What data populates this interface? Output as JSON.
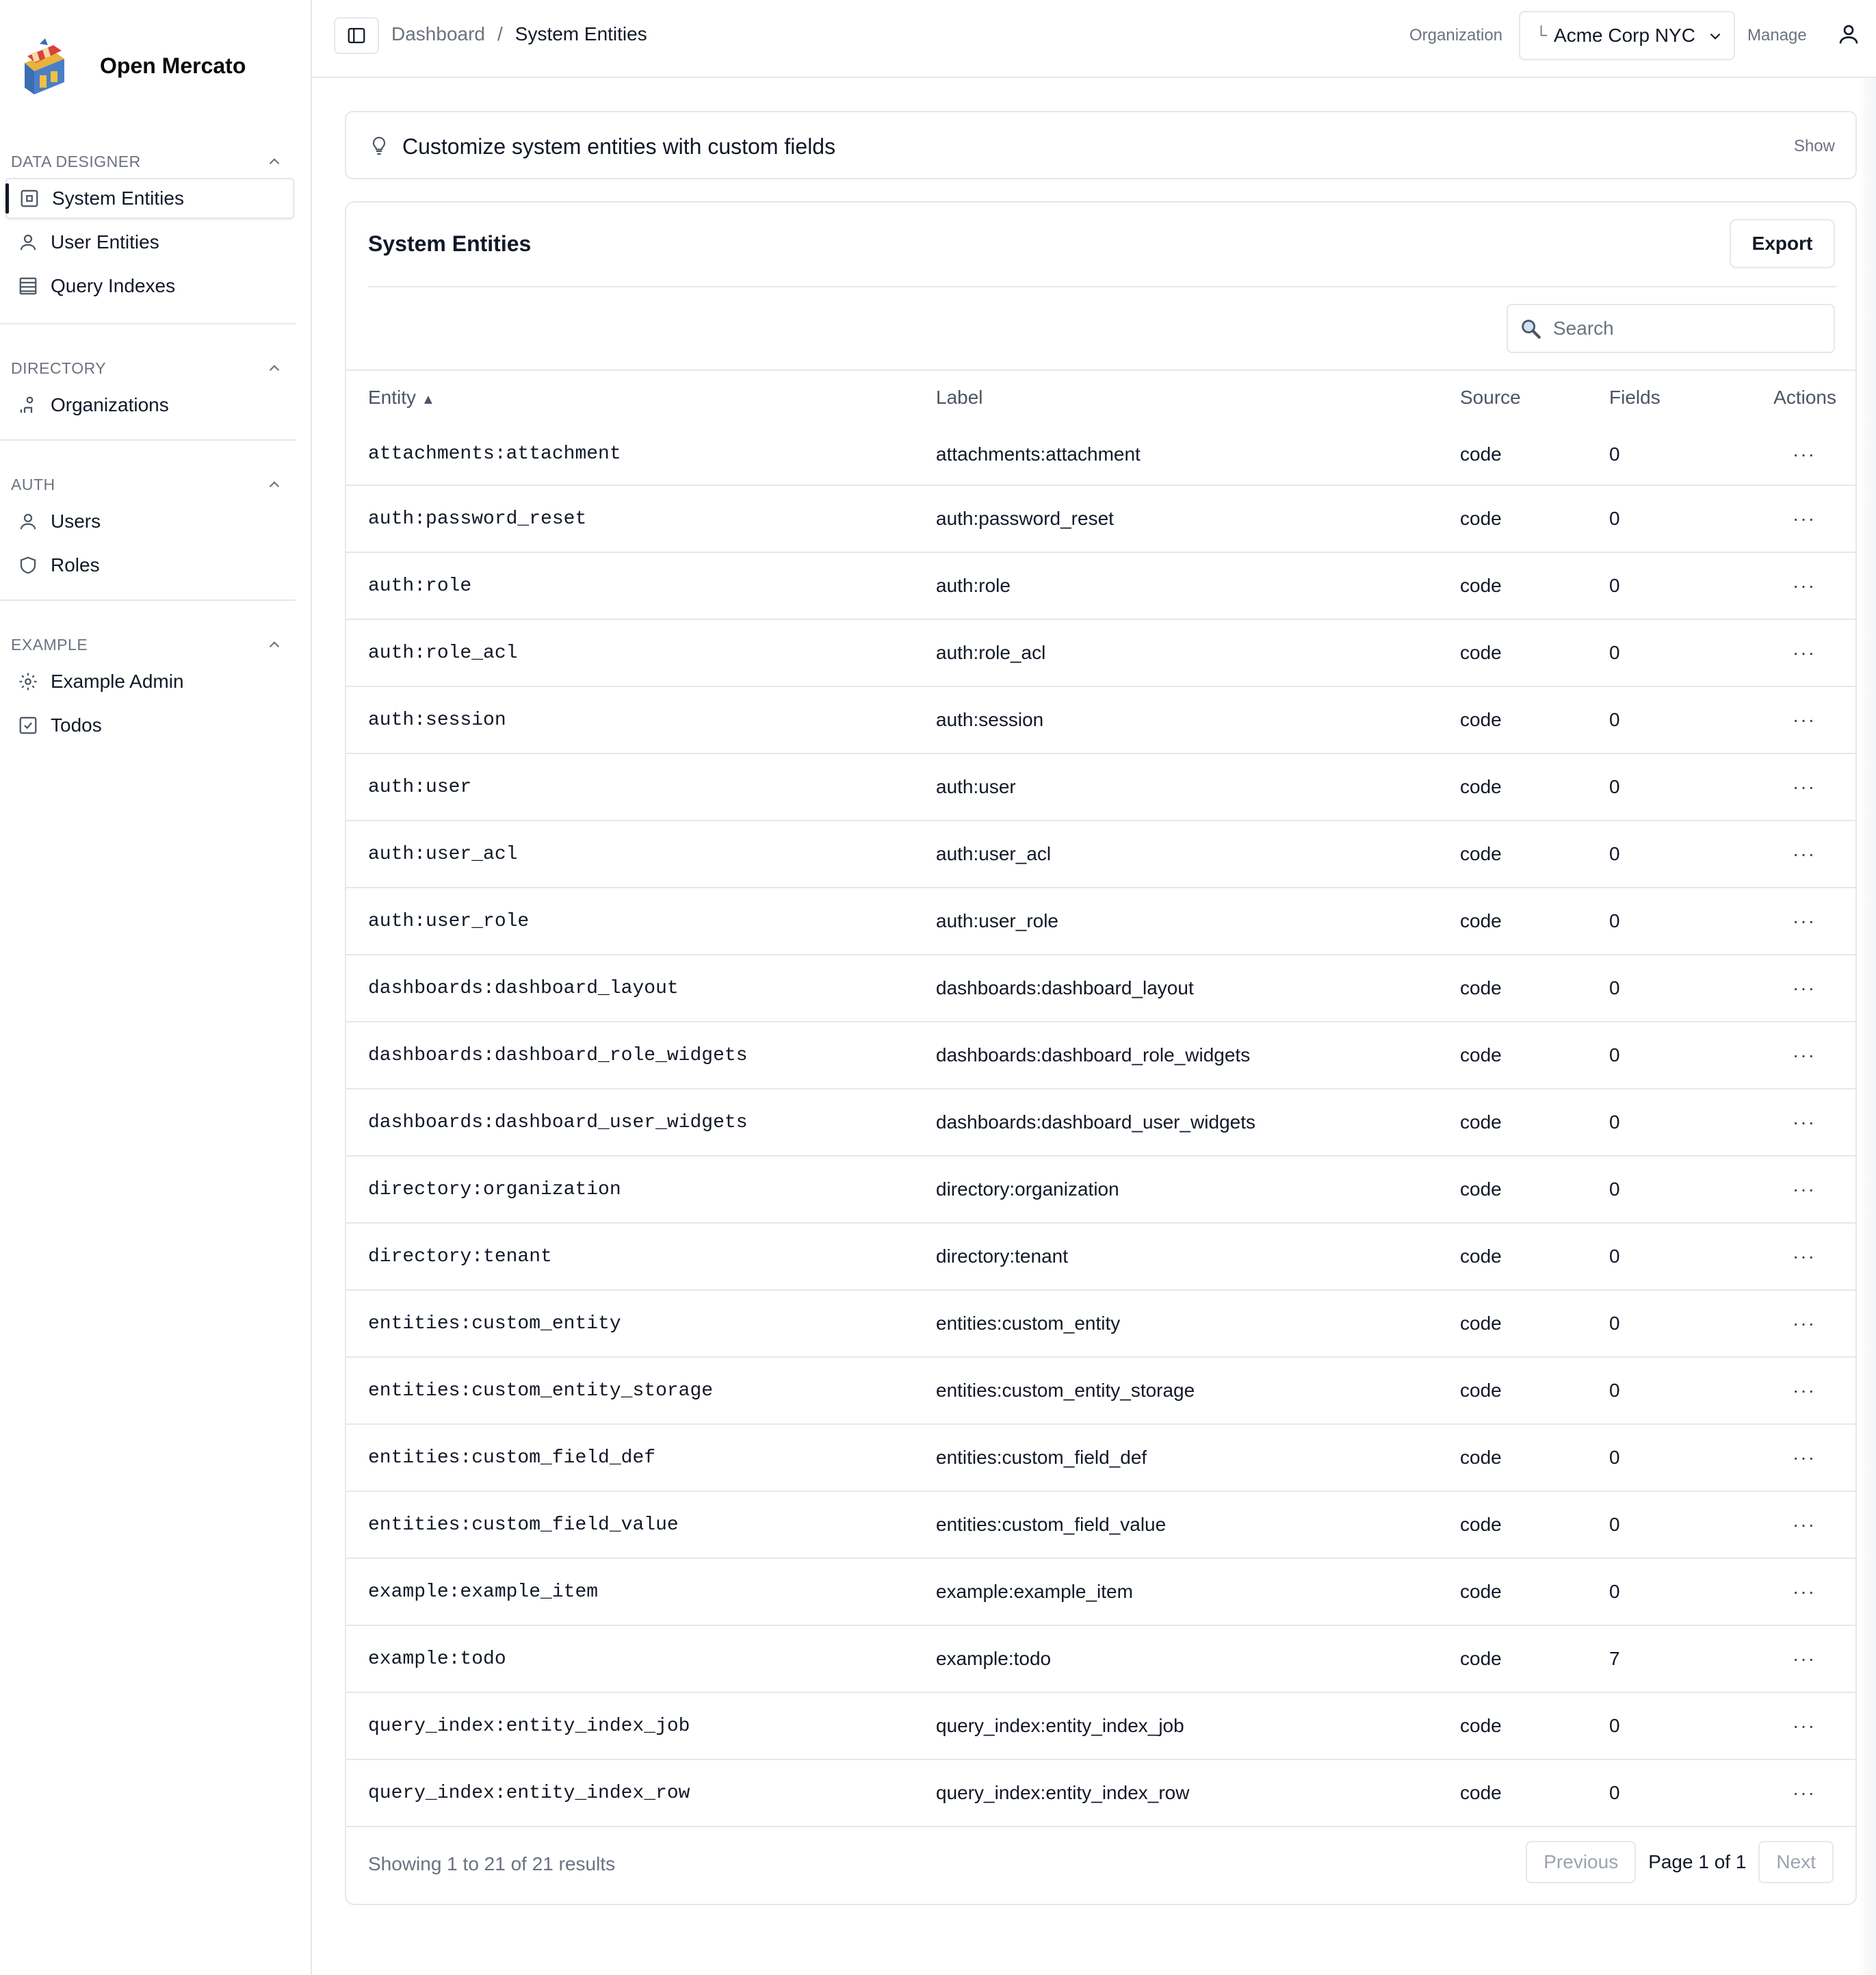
{
  "app": {
    "name": "Open Mercato"
  },
  "sidebar": {
    "sections": [
      {
        "title": "DATA DESIGNER",
        "items": [
          {
            "label": "System Entities",
            "icon": "box-icon",
            "active": true
          },
          {
            "label": "User Entities",
            "icon": "user-icon"
          },
          {
            "label": "Query Indexes",
            "icon": "database-icon"
          }
        ]
      },
      {
        "title": "DIRECTORY",
        "items": [
          {
            "label": "Organizations",
            "icon": "org-icon"
          }
        ]
      },
      {
        "title": "AUTH",
        "items": [
          {
            "label": "Users",
            "icon": "user-icon"
          },
          {
            "label": "Roles",
            "icon": "shield-icon"
          }
        ]
      },
      {
        "title": "EXAMPLE",
        "items": [
          {
            "label": "Example Admin",
            "icon": "gear-icon"
          },
          {
            "label": "Todos",
            "icon": "checkbox-icon"
          }
        ]
      }
    ]
  },
  "header": {
    "breadcrumb": [
      "Dashboard",
      "System Entities"
    ],
    "breadcrumb_sep": "/",
    "org_label": "Organization",
    "org_value": "Acme Corp NYC",
    "org_prefix": "└",
    "manage_label": "Manage"
  },
  "tip": {
    "text": "Customize system entities with custom fields",
    "toggle": "Show"
  },
  "card": {
    "title": "System Entities",
    "export_label": "Export",
    "search_placeholder": "Search",
    "columns": [
      "Entity",
      "Label",
      "Source",
      "Fields",
      "Actions"
    ],
    "sort_indicator": "▲",
    "actions_glyph": "···",
    "rows": [
      {
        "entity": "attachments:attachment",
        "label": "attachments:attachment",
        "source": "code",
        "fields": "0"
      },
      {
        "entity": "auth:password_reset",
        "label": "auth:password_reset",
        "source": "code",
        "fields": "0"
      },
      {
        "entity": "auth:role",
        "label": "auth:role",
        "source": "code",
        "fields": "0"
      },
      {
        "entity": "auth:role_acl",
        "label": "auth:role_acl",
        "source": "code",
        "fields": "0"
      },
      {
        "entity": "auth:session",
        "label": "auth:session",
        "source": "code",
        "fields": "0"
      },
      {
        "entity": "auth:user",
        "label": "auth:user",
        "source": "code",
        "fields": "0"
      },
      {
        "entity": "auth:user_acl",
        "label": "auth:user_acl",
        "source": "code",
        "fields": "0"
      },
      {
        "entity": "auth:user_role",
        "label": "auth:user_role",
        "source": "code",
        "fields": "0"
      },
      {
        "entity": "dashboards:dashboard_layout",
        "label": "dashboards:dashboard_layout",
        "source": "code",
        "fields": "0"
      },
      {
        "entity": "dashboards:dashboard_role_widgets",
        "label": "dashboards:dashboard_role_widgets",
        "source": "code",
        "fields": "0"
      },
      {
        "entity": "dashboards:dashboard_user_widgets",
        "label": "dashboards:dashboard_user_widgets",
        "source": "code",
        "fields": "0"
      },
      {
        "entity": "directory:organization",
        "label": "directory:organization",
        "source": "code",
        "fields": "0"
      },
      {
        "entity": "directory:tenant",
        "label": "directory:tenant",
        "source": "code",
        "fields": "0"
      },
      {
        "entity": "entities:custom_entity",
        "label": "entities:custom_entity",
        "source": "code",
        "fields": "0"
      },
      {
        "entity": "entities:custom_entity_storage",
        "label": "entities:custom_entity_storage",
        "source": "code",
        "fields": "0"
      },
      {
        "entity": "entities:custom_field_def",
        "label": "entities:custom_field_def",
        "source": "code",
        "fields": "0"
      },
      {
        "entity": "entities:custom_field_value",
        "label": "entities:custom_field_value",
        "source": "code",
        "fields": "0"
      },
      {
        "entity": "example:example_item",
        "label": "example:example_item",
        "source": "code",
        "fields": "0"
      },
      {
        "entity": "example:todo",
        "label": "example:todo",
        "source": "code",
        "fields": "7"
      },
      {
        "entity": "query_index:entity_index_job",
        "label": "query_index:entity_index_job",
        "source": "code",
        "fields": "0"
      },
      {
        "entity": "query_index:entity_index_row",
        "label": "query_index:entity_index_row",
        "source": "code",
        "fields": "0"
      }
    ],
    "footer_text": "Showing 1 to 21 of 21 results",
    "pagination": {
      "previous": "Previous",
      "page_label": "Page 1 of 1",
      "next": "Next"
    }
  }
}
